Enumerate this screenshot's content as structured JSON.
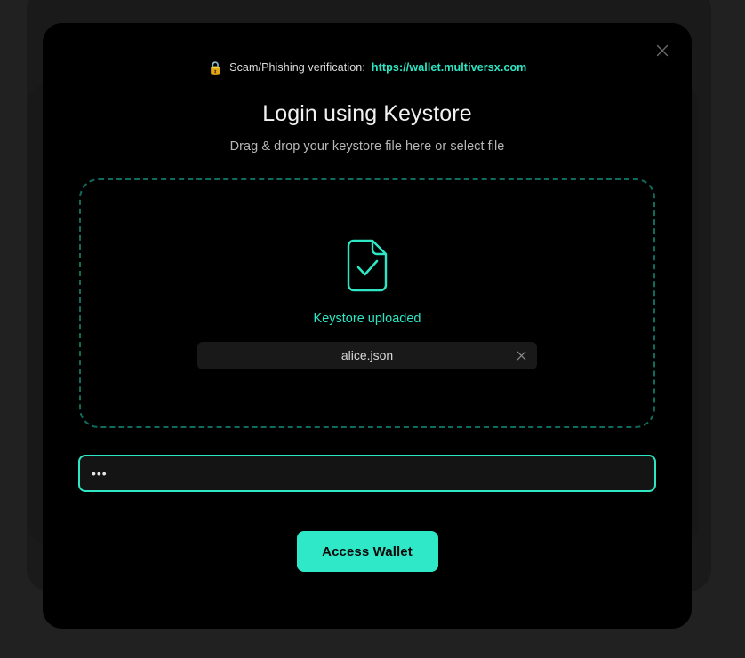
{
  "modal": {
    "close_icon": "close-icon",
    "phishing": {
      "lock_icon": "lock-icon",
      "lock_glyph": "🔒",
      "label": "Scam/Phishing verification:",
      "url": "https://wallet.multiversx.com",
      "url_color": "#2ee6c4"
    },
    "title": "Login using Keystore",
    "subtitle": "Drag & drop your keystore file here or select file",
    "dropzone": {
      "file_icon": "file-check-icon",
      "status_label": "Keystore uploaded",
      "status_color": "#2ee6c4",
      "border_color": "#0f6b5c",
      "file": {
        "name": "alice.json",
        "remove_icon": "close-icon"
      }
    },
    "password": {
      "value": "•••",
      "placeholder": "",
      "border_color": "#2ee6c4",
      "focused": true
    },
    "submit": {
      "label": "Access Wallet",
      "background": "#2ee8c8",
      "text_color": "#0a0a0a"
    }
  }
}
